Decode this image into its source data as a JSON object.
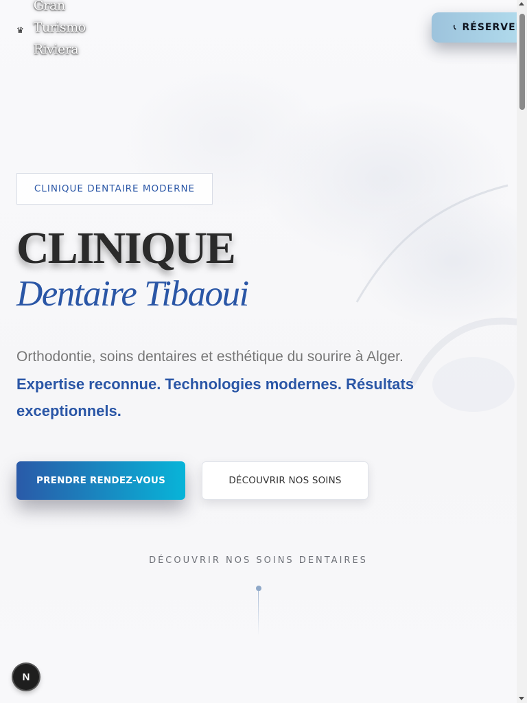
{
  "header": {
    "brand_lines": [
      "Gran",
      "Turismo",
      "Riviera"
    ],
    "brand_icon": "crown-icon",
    "reserve_icon": "phone-icon",
    "reserve_label": "RÉSERVER"
  },
  "hero": {
    "badge": "CLINIQUE DENTAIRE MODERNE",
    "title": "CLINIQUE",
    "subtitle": "Dentaire Tibaoui",
    "description": "Orthodontie, soins dentaires et esthétique du sourire à Alger.",
    "highlight": "Expertise reconnue. Technologies modernes. Résultats exceptionnels.",
    "primary_button": "PRENDRE RENDEZ-VOUS",
    "secondary_button": "DÉCOUVRIR NOS SOINS",
    "scroll_label": "DÉCOUVRIR NOS SOINS DENTAIRES"
  },
  "dev_badge": "N",
  "colors": {
    "accent_blue": "#2a56a6",
    "cta_gradient_start": "#2a5aa8",
    "cta_gradient_end": "#08b4d8",
    "reserve_gradient": "#9dc3dc"
  }
}
